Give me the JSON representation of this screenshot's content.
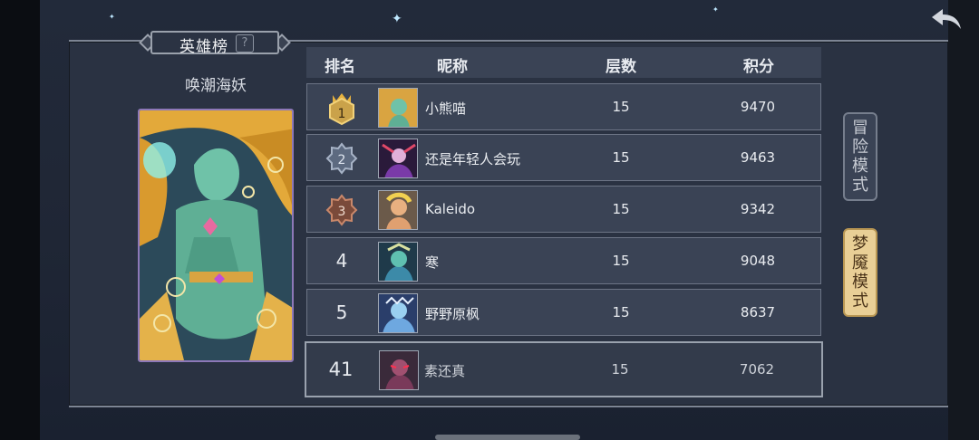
{
  "panel_title": "英雄榜",
  "help_label": "?",
  "hero_name": "唤潮海妖",
  "table": {
    "headers": [
      "排名",
      "昵称",
      "层数",
      "积分"
    ],
    "rows": [
      {
        "rank": "1",
        "nickname": "小熊喵",
        "floors": "15",
        "score": "9470",
        "medal": "gold"
      },
      {
        "rank": "2",
        "nickname": "还是年轻人会玩",
        "floors": "15",
        "score": "9463",
        "medal": "silver"
      },
      {
        "rank": "3",
        "nickname": "Kaleido",
        "floors": "15",
        "score": "9342",
        "medal": "bronze"
      },
      {
        "rank": "4",
        "nickname": "寒",
        "floors": "15",
        "score": "9048"
      },
      {
        "rank": "5",
        "nickname": "野野原枫",
        "floors": "15",
        "score": "8637"
      }
    ],
    "self_row": {
      "rank": "41",
      "nickname": "素还真",
      "floors": "15",
      "score": "7062"
    }
  },
  "modes": {
    "adventure": [
      "冒",
      "险",
      "模",
      "式"
    ],
    "nightmare": [
      "梦",
      "魇",
      "模",
      "式"
    ]
  },
  "icons": {
    "back": "back-arrow-icon",
    "help": "question-icon"
  },
  "colors": {
    "panel": "#2a3242",
    "row": "#3a4355",
    "nightmare_active": "#e9cf96",
    "gold": "#d9a441",
    "silver": "#8e9bb0",
    "bronze": "#b56b4b"
  }
}
